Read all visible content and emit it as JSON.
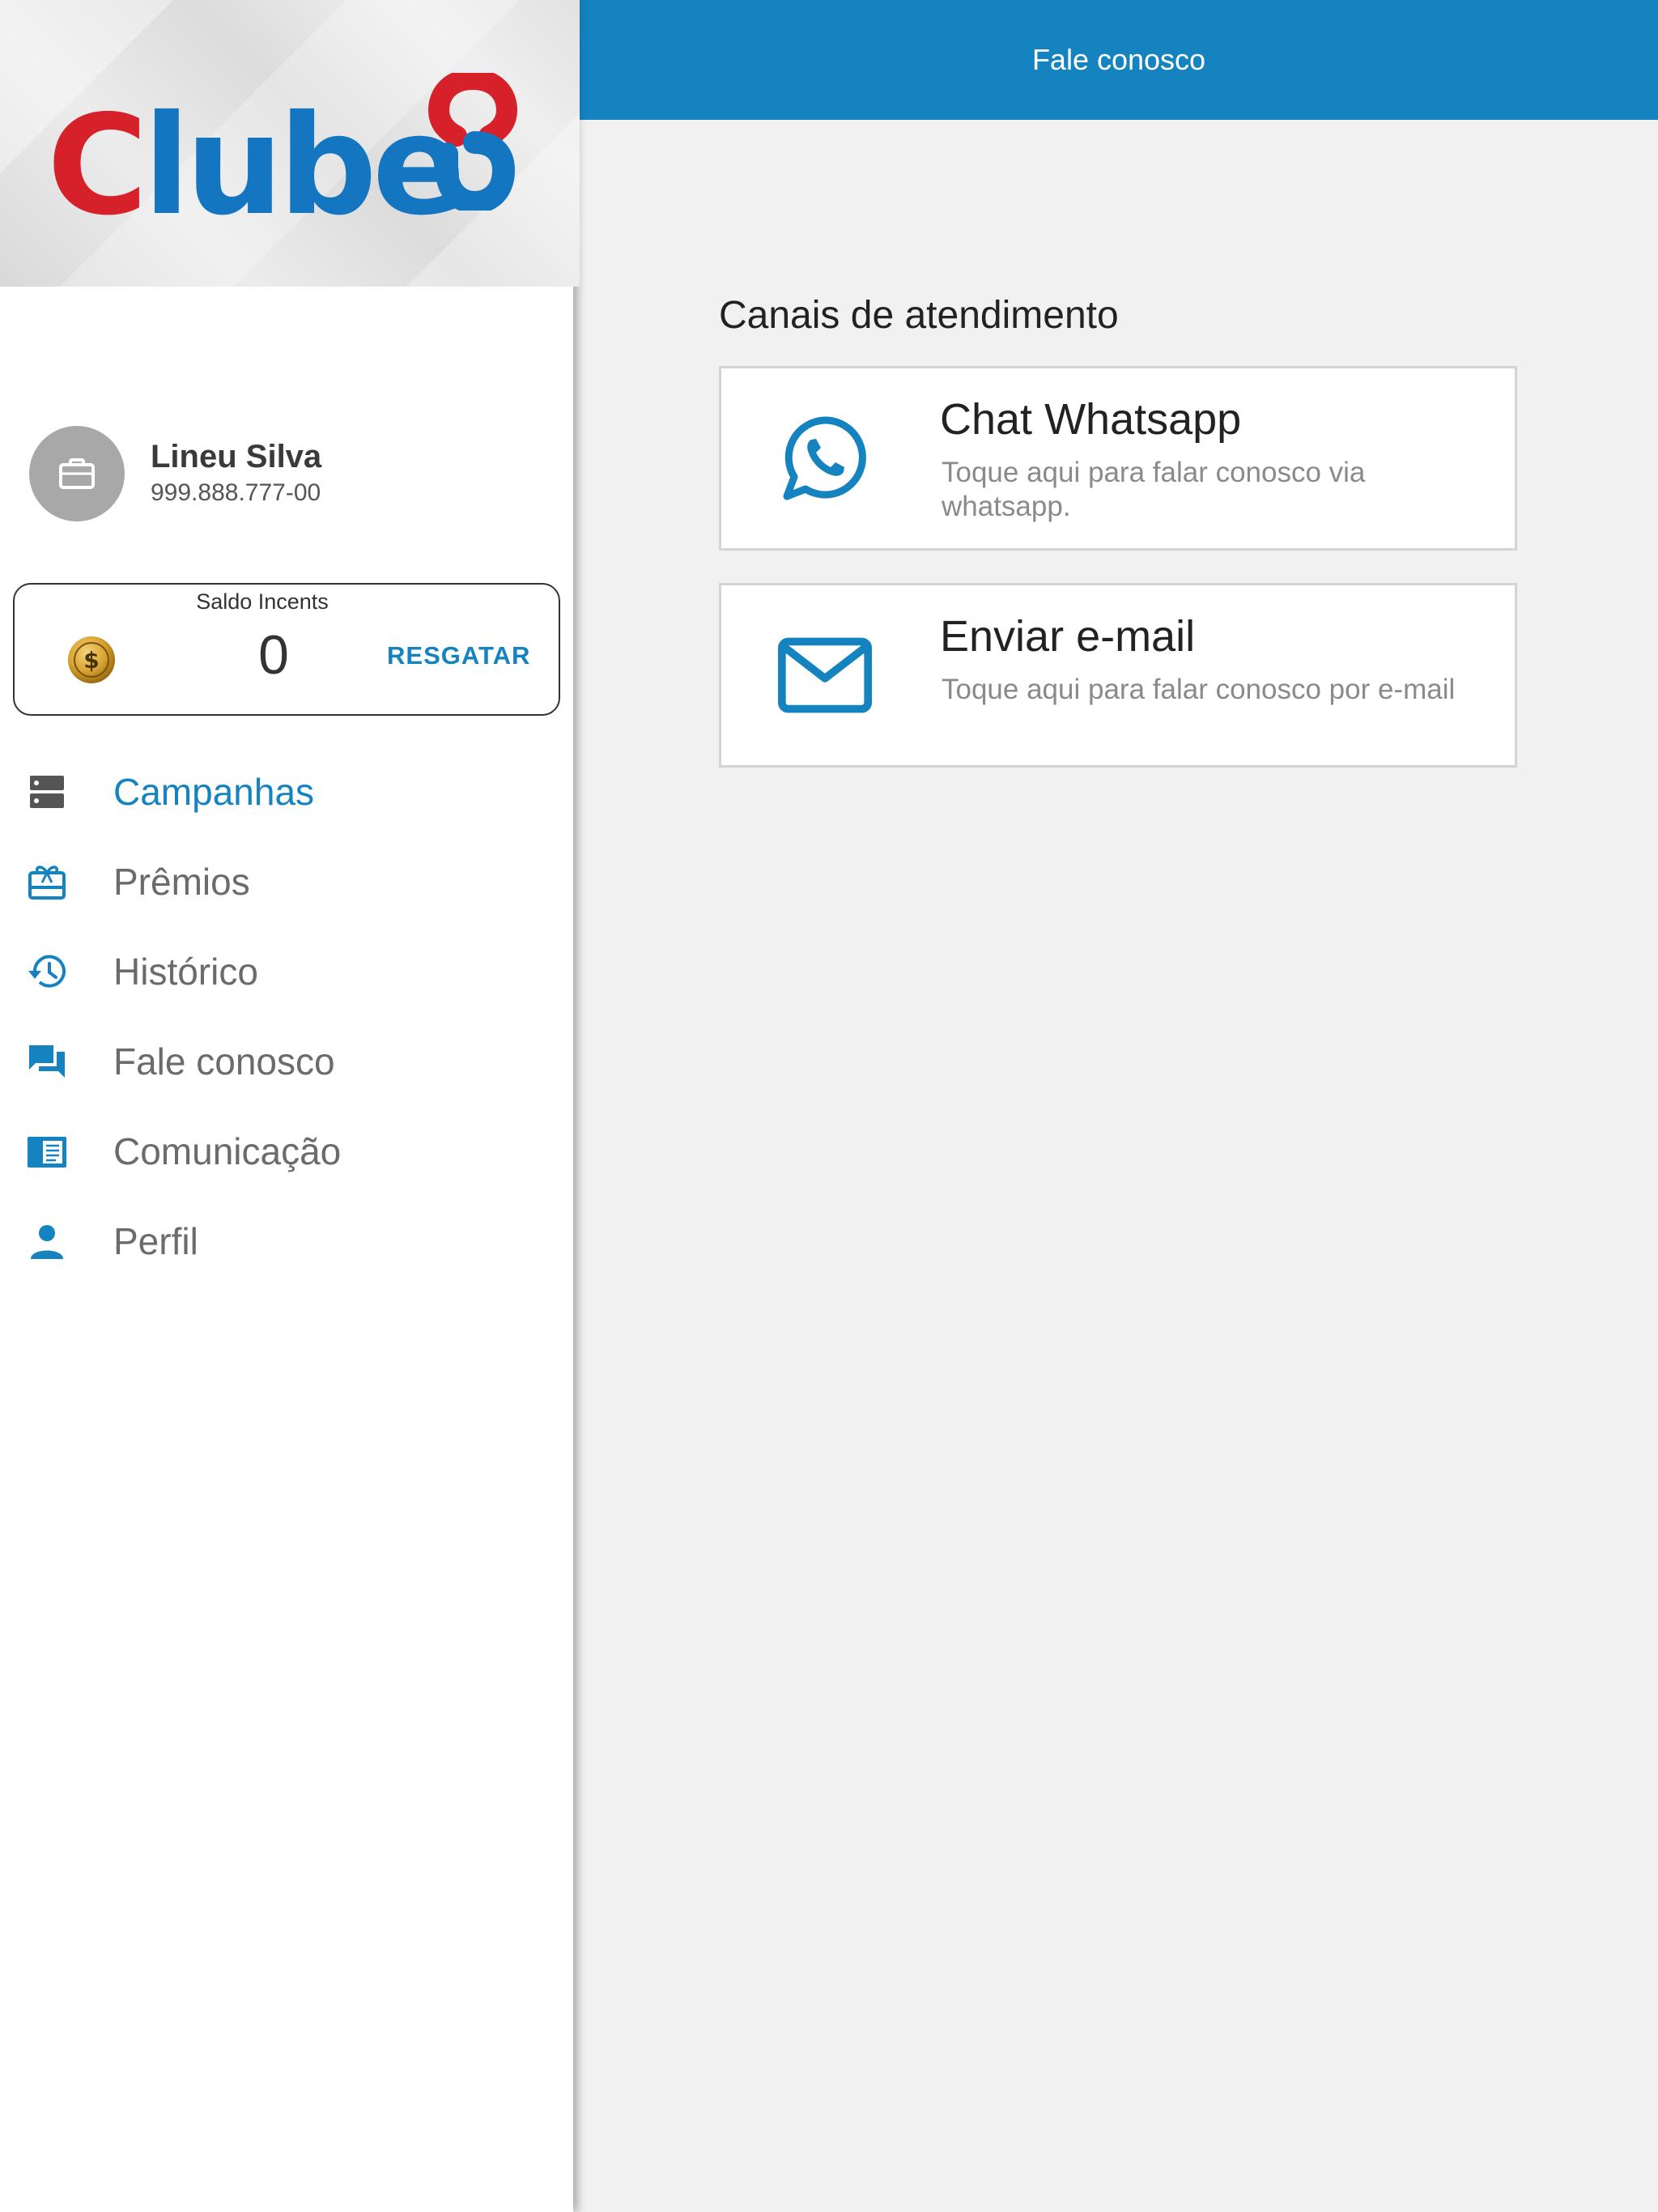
{
  "brand": {
    "logo_text_first": "C",
    "logo_text_rest": "lube",
    "colors": {
      "red": "#d6202a",
      "blue": "#1475c0"
    }
  },
  "user": {
    "name": "Lineu Silva",
    "document": "999.888.777-00",
    "avatar_icon": "briefcase-icon"
  },
  "balance": {
    "label": "Saldo Incents",
    "value": "0",
    "redeem_label": "RESGATAR",
    "icon": "coin-icon"
  },
  "menu": {
    "items": [
      {
        "label": "Campanhas",
        "icon": "campaigns-icon",
        "active": true
      },
      {
        "label": "Prêmios",
        "icon": "gift-card-icon",
        "active": false
      },
      {
        "label": "Histórico",
        "icon": "history-icon",
        "active": false
      },
      {
        "label": "Fale conosco",
        "icon": "chat-icon",
        "active": false
      },
      {
        "label": "Comunicação",
        "icon": "newspaper-icon",
        "active": false
      },
      {
        "label": "Perfil",
        "icon": "person-icon",
        "active": false
      }
    ]
  },
  "appbar": {
    "title": "Fale conosco"
  },
  "contact": {
    "section_title": "Canais de atendimento",
    "channels": [
      {
        "title": "Chat Whatsapp",
        "description": "Toque aqui para falar conosco via whatsapp.",
        "icon": "whatsapp-icon"
      },
      {
        "title": "Enviar e-mail",
        "description": "Toque aqui para falar conosco por e-mail",
        "icon": "mail-icon"
      }
    ]
  },
  "colors": {
    "primary": "#1583c0",
    "text_muted": "#6b6b6b",
    "background": "#f1f1f1"
  }
}
